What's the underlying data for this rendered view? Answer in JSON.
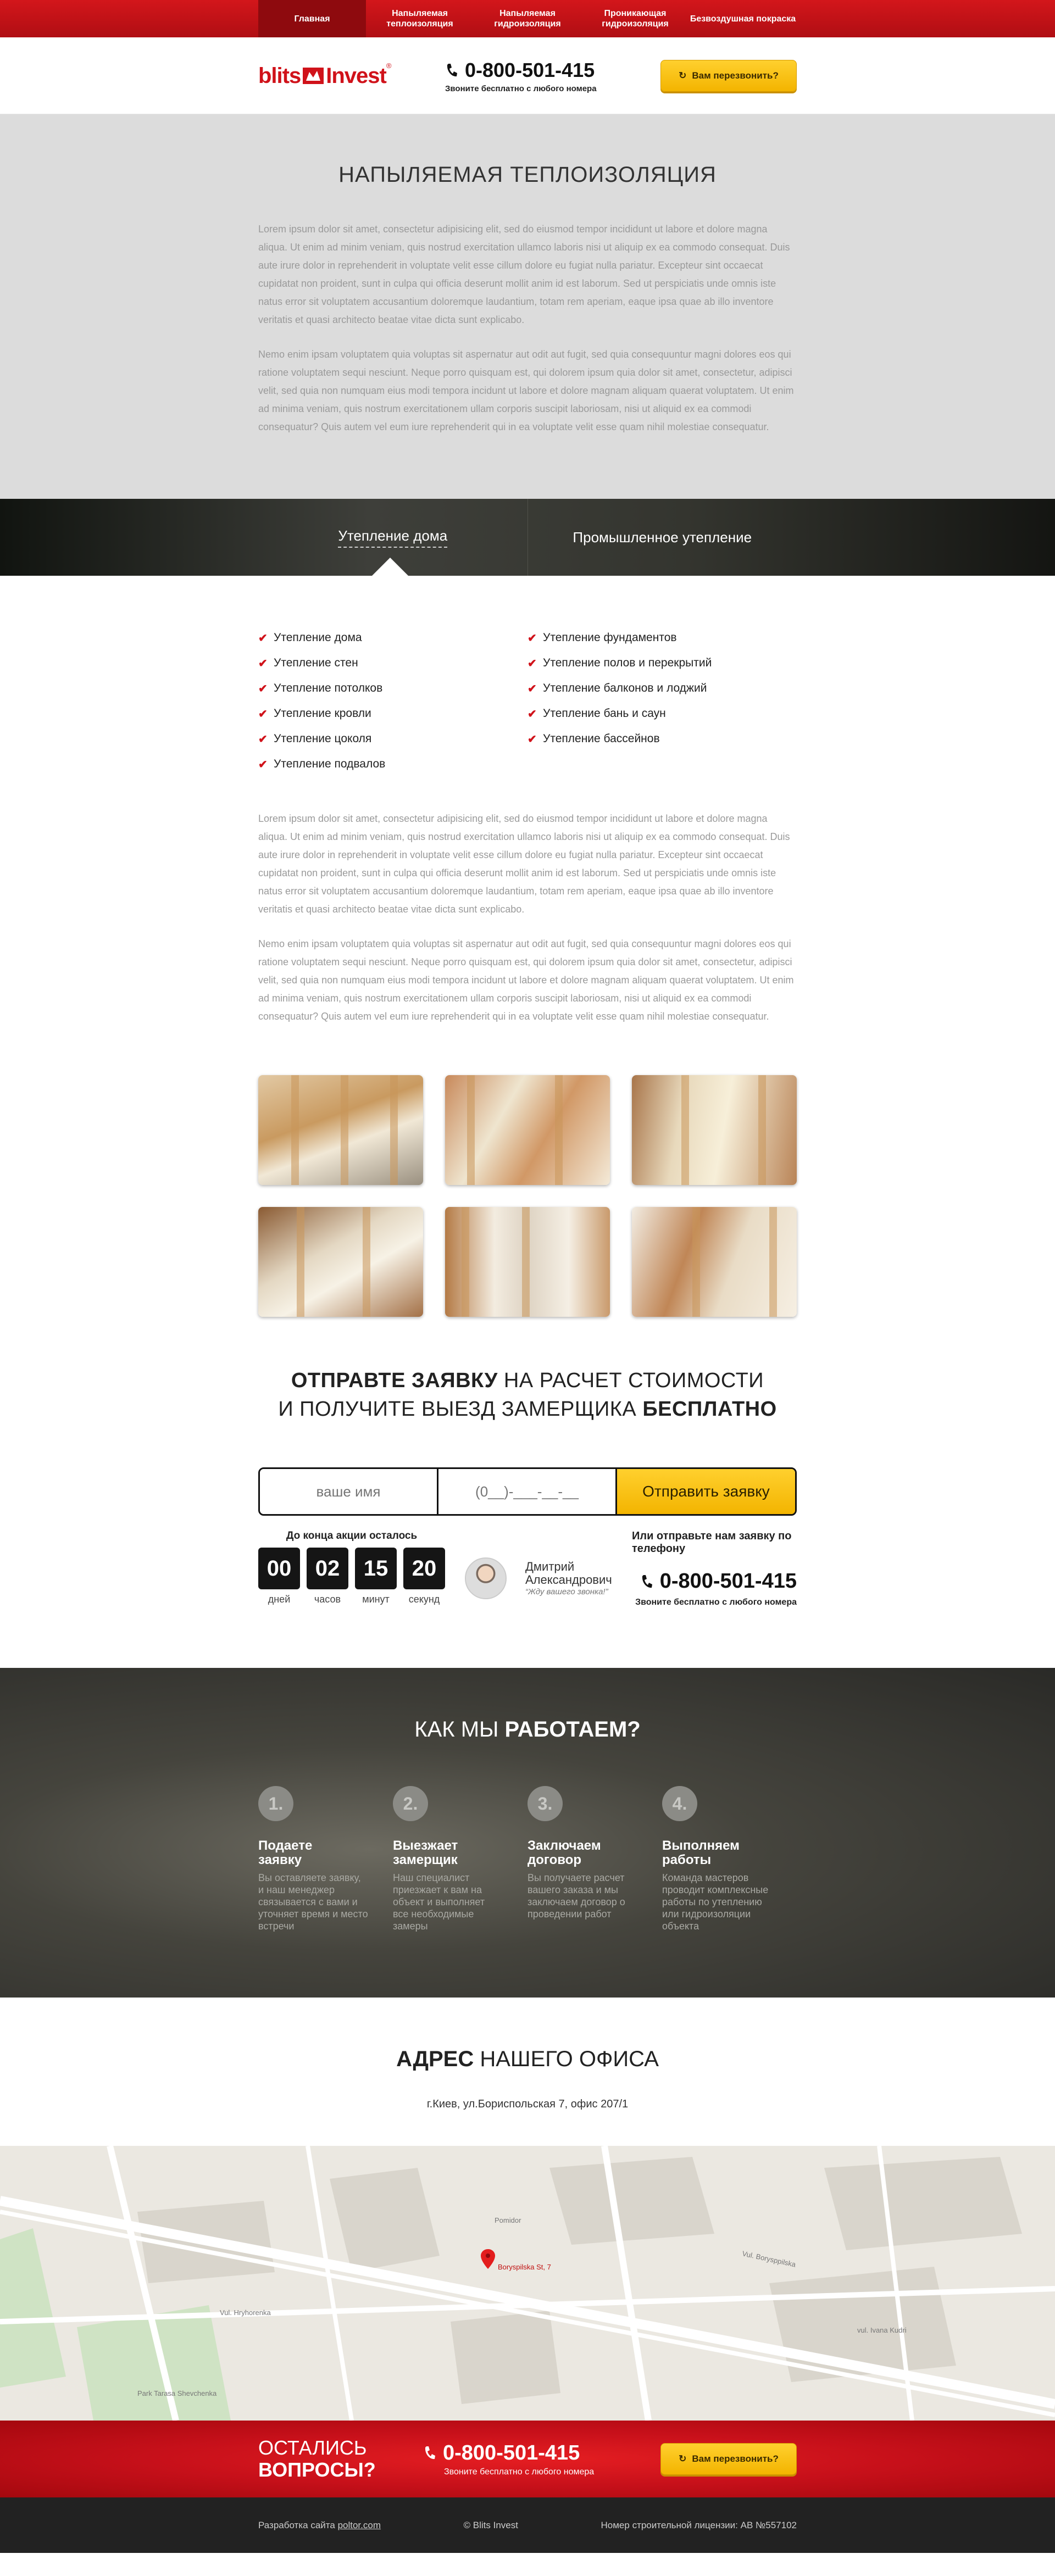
{
  "nav": {
    "items": [
      {
        "label": "Главная",
        "active": true
      },
      {
        "label": "Напыляемая теплоизоляция"
      },
      {
        "label": "Напыляемая гидроизоляция"
      },
      {
        "label": "Проникающая гидроизоляция"
      },
      {
        "label": "Безвоздушная покраска"
      }
    ]
  },
  "header": {
    "logo": {
      "left": "blits",
      "right": "Invest",
      "reg": "®"
    },
    "phone": "0-800-501-415",
    "phone_sub": "Звоните бесплатно с любого номера",
    "callback": "Вам перезвонить?"
  },
  "intro": {
    "title": "НАПЫЛЯЕМАЯ ТЕПЛОИЗОЛЯЦИЯ",
    "p1": "Lorem ipsum dolor sit amet, consectetur adipisicing elit, sed do eiusmod tempor incididunt ut labore et dolore magna aliqua. Ut enim ad minim veniam, quis nostrud exercitation ullamco laboris nisi ut aliquip ex ea commodo consequat. Duis aute irure dolor in reprehenderit in voluptate velit esse cillum dolore eu fugiat nulla pariatur. Excepteur sint occaecat cupidatat non proident, sunt in culpa qui officia deserunt mollit anim id est laborum. Sed ut perspiciatis unde omnis iste natus error sit voluptatem accusantium doloremque laudantium, totam rem aperiam, eaque ipsa quae ab illo inventore veritatis et quasi architecto beatae vitae dicta sunt explicabo.",
    "p2": "Nemo enim ipsam voluptatem quia voluptas sit aspernatur aut odit aut fugit, sed quia consequuntur magni dolores eos qui ratione voluptatem sequi nesciunt. Neque porro quisquam est, qui dolorem ipsum quia dolor sit amet, consectetur, adipisci velit, sed quia non numquam eius modi tempora incidunt ut labore et dolore magnam aliquam quaerat voluptatem. Ut enim ad minima veniam, quis nostrum exercitationem ullam corporis suscipit laboriosam, nisi ut aliquid ex ea commodi consequatur? Quis autem vel eum iure reprehenderit qui in ea voluptate velit esse quam nihil molestiae consequatur."
  },
  "tabs": [
    {
      "label": "Утепление дома",
      "active": true
    },
    {
      "label": "Промышленное утепление"
    }
  ],
  "checklist": {
    "left": [
      "Утепление дома",
      "Утепление стен",
      "Утепление потолков",
      "Утепление кровли",
      "Утепление цоколя",
      "Утепление подвалов"
    ],
    "right": [
      "Утепление фундаментов",
      "Утепление полов и перекрытий",
      "Утепление балконов и лоджий",
      "Утепление бань и саун",
      "Утепление бассейнов"
    ]
  },
  "desc": {
    "p1": "Lorem ipsum dolor sit amet, consectetur adipisicing elit, sed do eiusmod tempor incididunt ut labore et dolore magna aliqua. Ut enim ad minim veniam, quis nostrud exercitation ullamco laboris nisi ut aliquip ex ea commodo consequat. Duis aute irure dolor in reprehenderit in voluptate velit esse cillum dolore eu fugiat nulla pariatur. Excepteur sint occaecat cupidatat non proident, sunt in culpa qui officia deserunt mollit anim id est laborum. Sed ut perspiciatis unde omnis iste natus error sit voluptatem accusantium doloremque laudantium, totam rem aperiam, eaque ipsa quae ab illo inventore veritatis et quasi architecto beatae vitae dicta sunt explicabo.",
    "p2": "Nemo enim ipsam voluptatem quia voluptas sit aspernatur aut odit aut fugit, sed quia consequuntur magni dolores eos qui ratione voluptatem sequi nesciunt. Neque porro quisquam est, qui dolorem ipsum quia dolor sit amet, consectetur, adipisci velit, sed quia non numquam eius modi tempora incidunt ut labore et dolore magnam aliquam quaerat voluptatem. Ut enim ad minima veniam, quis nostrum exercitationem ullam corporis suscipit laboriosam, nisi ut aliquid ex ea commodi consequatur? Quis autem vel eum iure reprehenderit qui in ea voluptate velit esse quam nihil molestiae consequatur."
  },
  "order": {
    "line1_bold": "ОТПРАВТЕ ЗАЯВКУ",
    "line1_rest": " НА РАСЧЕТ СТОИМОСТИ",
    "line2_rest": "И ПОЛУЧИТЕ ВЫЕЗД ЗАМЕРЩИКА ",
    "line2_bold": "БЕСПЛАТНО",
    "name_placeholder": "ваше имя",
    "phone_placeholder": "(0__)-___-__-__",
    "submit": "Отправить заявку"
  },
  "countdown": {
    "title": "До конца акции осталось",
    "items": [
      {
        "value": "00",
        "label": "дней"
      },
      {
        "value": "02",
        "label": "часов"
      },
      {
        "value": "15",
        "label": "минут"
      },
      {
        "value": "20",
        "label": "секунд"
      }
    ]
  },
  "manager": {
    "name": "Дмитрий Александрович",
    "quote": "“Жду вашего звонка!”"
  },
  "phoneblock": {
    "title": "Или отправьте нам заявку по телефону",
    "phone": "0-800-501-415",
    "sub": "Звоните бесплатно с любого номера"
  },
  "how": {
    "title_rest": "КАК МЫ ",
    "title_bold": "РАБОТАЕМ?",
    "steps": [
      {
        "num": "1.",
        "title": "Подаете заявку",
        "text": "Вы оставляете заявку, и наш менеджер связывается с вами и уточняет время и место встречи"
      },
      {
        "num": "2.",
        "title": "Выезжает замерщик",
        "text": "Наш специалист приезжает к вам на объект и выполняет все необходимые замеры"
      },
      {
        "num": "3.",
        "title": "Заключаем договор",
        "text": "Вы получаете расчет вашего заказа и мы заключаем договор о проведении работ"
      },
      {
        "num": "4.",
        "title": "Выполняем работы",
        "text": "Команда мастеров проводит комплексные работы по утеплению или гидроизоляции объекта"
      }
    ]
  },
  "address": {
    "title_bold": "АДРЕС",
    "title_rest": " НАШЕГО ОФИСА",
    "text": "г.Киев, ул.Бориспольская 7, офис 207/1"
  },
  "map": {
    "marker_label": "Boryspilska St, 7",
    "labels": [
      "Vul. Borysppilska",
      "Vul. Hryhorenka",
      "vul. Ivana Kudri",
      "Pomidor",
      "Park Tarasa Shevchenka"
    ]
  },
  "cta": {
    "q1": "ОСТАЛИСЬ",
    "q2": "ВОПРОСЫ?",
    "phone": "0-800-501-415",
    "sub": "Звоните бесплатно с любого номера",
    "callback": "Вам перезвонить?"
  },
  "footer": {
    "dev_prefix": "Разработка сайта ",
    "dev_link": "poltor.com",
    "copyright": "© Blits Invest",
    "license": "Номер строительной лицензии: АВ №557102"
  },
  "colors": {
    "brand_red": "#d0121a",
    "accent_yellow": "#f6c000",
    "dark": "#222222"
  }
}
